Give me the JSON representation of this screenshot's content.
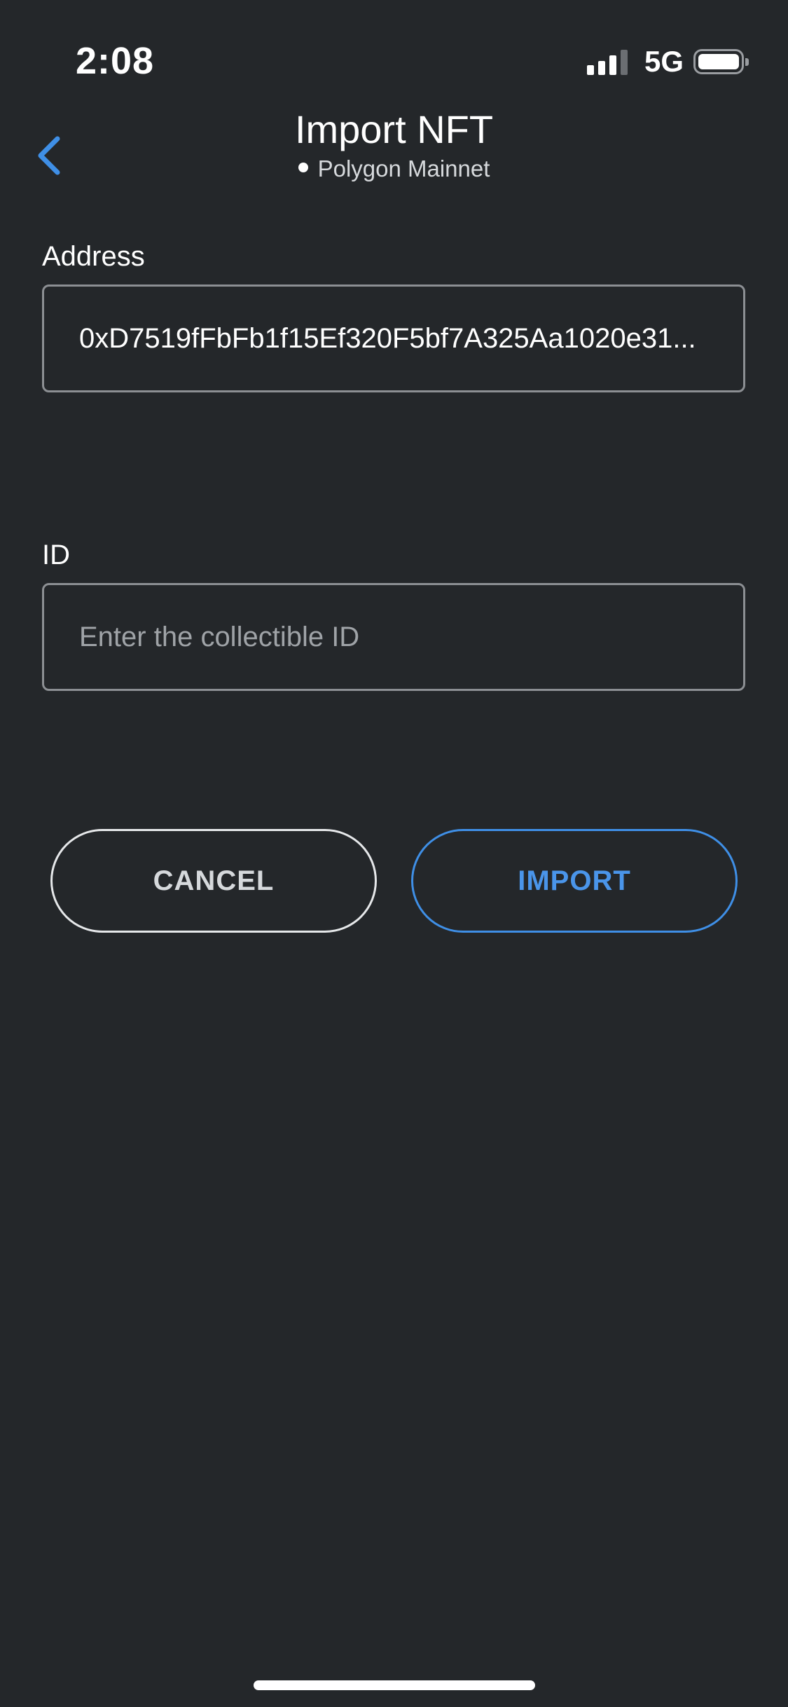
{
  "status_bar": {
    "time": "2:08",
    "network": "5G",
    "signal_bars_active": 3,
    "signal_bars_total": 4,
    "battery_icon": "battery-full-icon"
  },
  "header": {
    "back_icon": "chevron-left-icon",
    "title": "Import NFT",
    "network_name": "Polygon Mainnet"
  },
  "form": {
    "address": {
      "label": "Address",
      "value": "0xD7519fFbFb1f15Ef320F5bf7A325Aa1020e31..."
    },
    "id": {
      "label": "ID",
      "placeholder": "Enter the collectible ID",
      "value": ""
    }
  },
  "actions": {
    "cancel_label": "CANCEL",
    "import_label": "IMPORT"
  },
  "colors": {
    "background": "#24272a",
    "accent": "#4a95ea",
    "text_primary": "#ffffff",
    "text_secondary": "#d6d9dc",
    "placeholder": "#9fa3a7",
    "input_border": "#8c8f93"
  }
}
